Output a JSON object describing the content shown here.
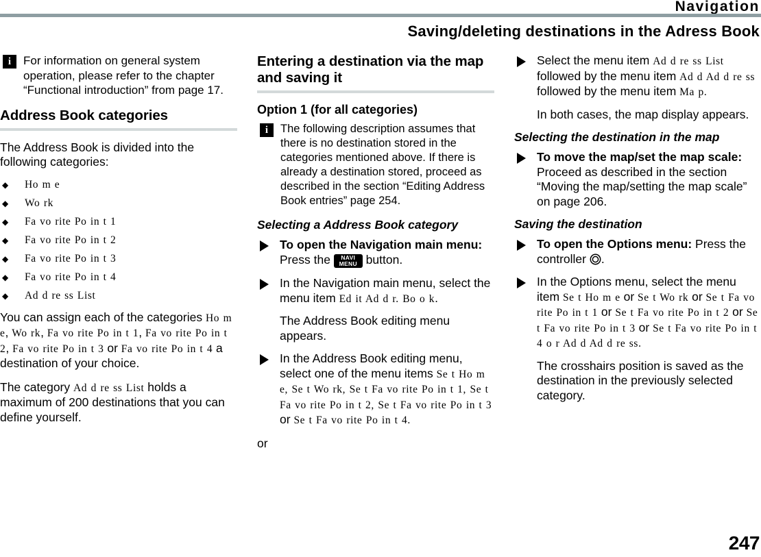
{
  "header": {
    "running_head": "Navigation",
    "subtitle": "Saving/deleting destinations in the Adress Book",
    "rule_color": "#8e9ea2",
    "section_rule_color": "#d3d9da"
  },
  "footer": {
    "page_number": "247"
  },
  "icons": {
    "info": "i",
    "diamond_bullet": "◆",
    "triangle_bullet": "action-triangle",
    "navi_key_line1": "NAVI",
    "navi_key_line2": "MENU",
    "controller": "double-circle"
  },
  "column_left": {
    "note": {
      "icon": "info-icon",
      "text": "For information on general system operation, please refer to the chapter “Functional introduction” from page 17."
    },
    "heading": "Address Book categories",
    "intro": "The Address Book is divided into the following categories:",
    "categories": [
      "Ho m e",
      "Wo rk",
      "Fa vo rite  Po in t 1",
      "Fa vo rite  Po in t 2",
      "Fa vo rite  Po in t 3",
      "Fa vo rite  Po in t 4",
      "Ad d re ss  List"
    ],
    "assign_paragraph": {
      "part1": "You can assign each of the categories ",
      "menu1": "Ho m e",
      "sep1": ", ",
      "menu2": "Wo rk",
      "sep2": ", ",
      "menu3": "Fa vo rite  Po in t 1",
      "sep3": ", ",
      "menu4": "Fa vo rite  Po in t 2",
      "sep4": ", ",
      "menu5": "Fa vo rite  Po in t 3",
      "or": " or ",
      "menu6": "Fa vo rite  Po in t 4",
      "part2": " a destination of your choice."
    },
    "capacity_paragraph": {
      "part1": "The category ",
      "menu": "Ad d re ss  List",
      "part2": " holds a maximum of 200 destinations that you can define yourself."
    }
  },
  "column_middle": {
    "heading": "Entering a destination via the map and saving it",
    "subheading": "Option 1 (for all categories)",
    "note": {
      "icon": "info-icon",
      "text": "The following description assumes that there is no destination stored in the categories mentioned above. If there is already a destination stored, proceed as described in the section “Editing Address Book entries” page 254."
    },
    "section_title": "Selecting a Address Book category",
    "step1": {
      "bold": "To open the Navigation main menu:",
      "text_before": "Press the ",
      "key": "NAVI MENU",
      "text_after": " button."
    },
    "step2": {
      "text_before": "In the Navigation main menu, select the menu item ",
      "menu": "Ed it Ad d r.  Bo o k",
      "text_after": "."
    },
    "step2_result": "The Address Book editing menu appears.",
    "step3": {
      "text_before": "In the Address Book editing menu, select one of the menu items ",
      "menu1": "Se t Ho m e",
      "sep1": ", ",
      "menu2": "Se t Wo rk",
      "sep2": ", ",
      "menu3": "Se t Fa vo rite  Po in t 1",
      "sep3": ", ",
      "menu4": "Se t Fa vo rite  Po in t 2",
      "sep4": ", ",
      "menu5": "Se t Fa vo rite  Po in t 3",
      "or": " or ",
      "menu6": "Se t Fa vo rite  Po in t 4",
      "text_after": "."
    },
    "or_label": "or"
  },
  "column_right": {
    "step1": {
      "text1": "Select the menu item ",
      "menu1": "Ad d re ss  List",
      "text2": " followed by the menu item ",
      "menu2": "Ad d Ad d re ss",
      "text3": " followed by the menu item ",
      "menu3": "Ma p",
      "text4": "."
    },
    "step1_result": "In both cases, the map display appears.",
    "section_title_1": "Selecting the destination in the map",
    "step2": {
      "bold": "To move the map/set the map scale:",
      "text": "Proceed as described in the section “Moving the map/setting the map scale” on page 206."
    },
    "section_title_2": "Saving the destination",
    "step3": {
      "bold": "To open the Options menu:",
      "text_before": " Press the controller ",
      "icon": "controller-icon",
      "text_after": "."
    },
    "step4": {
      "text_before": "In the Options menu, select the menu item ",
      "menu1": "Se t Ho m e",
      "or1": " or ",
      "menu2": "Se t Wo rk",
      "or2": " or ",
      "menu3": "Se t Fa vo rite  Po in t 1",
      "or3": " or ",
      "menu4": "Se t Fa vo rite  Po in t 2",
      "or4": " or ",
      "menu5": "Se t Fa vo rite  Po in t 3",
      "or5": " or ",
      "menu6": "Se t Fa vo rite  Po in t 4",
      "or6": " o r ",
      "menu7": "Ad d  Ad d re ss",
      "text_after": "."
    },
    "step4_result": "The crosshairs position is saved as the destination in the previously selected category."
  }
}
